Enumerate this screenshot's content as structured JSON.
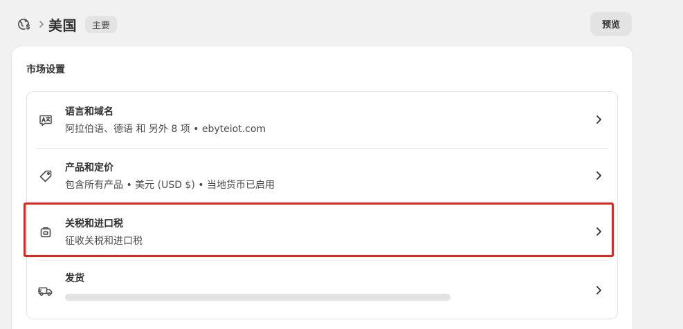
{
  "header": {
    "title": "美国",
    "badge": "主要",
    "preview_label": "预览"
  },
  "card": {
    "title": "市场设置",
    "rows": [
      {
        "icon": "language-icon",
        "title": "语言和域名",
        "subtitle": "阿拉伯语、德语 和 另外 8 项 • ebyteiot.com"
      },
      {
        "icon": "tag-icon",
        "title": "产品和定价",
        "subtitle": "包含所有产品 • 美元 (USD $) • 当地货币已启用"
      },
      {
        "icon": "duties-icon",
        "title": "关税和进口税",
        "subtitle": "征收关税和进口税",
        "highlighted": true
      },
      {
        "icon": "truck-icon",
        "title": "发货",
        "subtitle": "",
        "loading": true
      }
    ]
  },
  "colors": {
    "highlight": "#e2231a",
    "background": "#f1f1f1",
    "card": "#ffffff"
  }
}
